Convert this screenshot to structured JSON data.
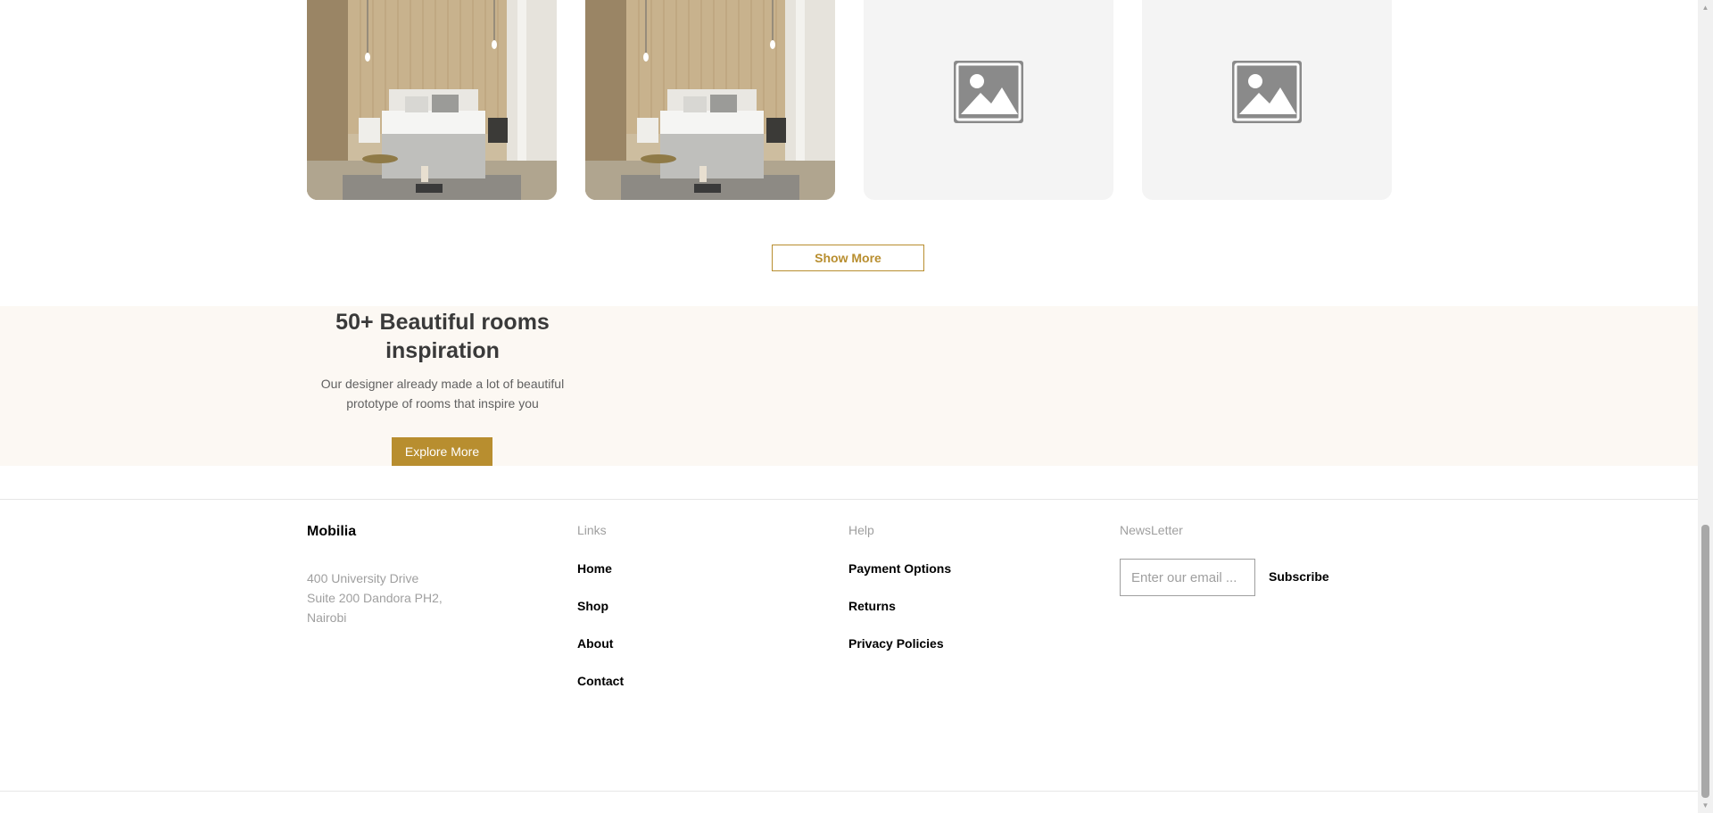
{
  "products": [
    {
      "kind": "photo",
      "icon": "bedroom-photo"
    },
    {
      "kind": "photo",
      "icon": "bedroom-photo"
    },
    {
      "kind": "placeholder",
      "icon": "image-placeholder-icon"
    },
    {
      "kind": "placeholder",
      "icon": "image-placeholder-icon"
    }
  ],
  "show_more_label": "Show More",
  "inspiration": {
    "title": "50+ Beautiful rooms inspiration",
    "subtitle": "Our designer already made a lot of beautiful prototype of rooms that inspire you",
    "button_label": "Explore More"
  },
  "footer": {
    "brand": "Mobilia",
    "address": [
      "400 University Drive",
      "Suite 200 Dandora PH2,",
      "Nairobi"
    ],
    "links_heading": "Links",
    "links": [
      "Home",
      "Shop",
      "About",
      "Contact"
    ],
    "help_heading": "Help",
    "help": [
      "Payment Options",
      "Returns",
      "Privacy Policies"
    ],
    "newsletter_heading": "NewsLetter",
    "email_placeholder": "Enter our email ...",
    "subscribe_label": "Subscribe"
  },
  "colors": {
    "accent": "#b88e2f",
    "inspiration_bg": "#fcf8f3",
    "muted_text": "#9f9f9f"
  }
}
